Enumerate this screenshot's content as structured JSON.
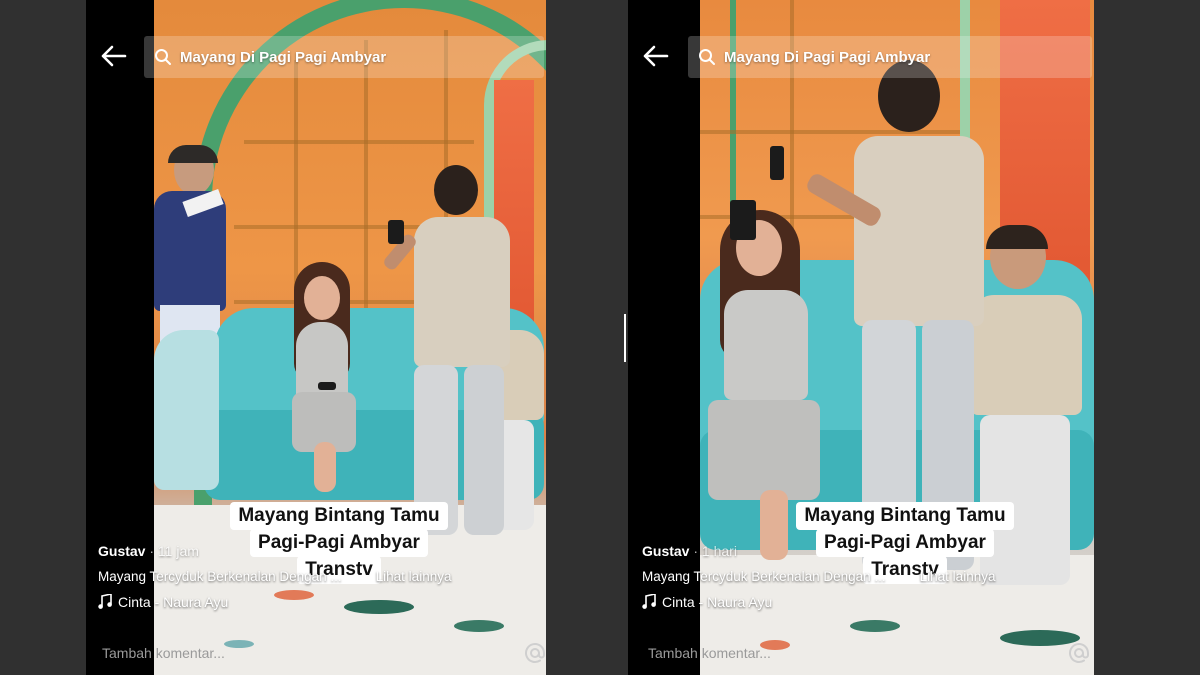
{
  "screens": [
    {
      "search": {
        "query": "Mayang Di Pagi Pagi Ambyar"
      },
      "overlay_caption": [
        "Mayang Bintang Tamu",
        "Pagi-Pagi Ambyar",
        "Transtv"
      ],
      "author": "Gustav",
      "author_time": "· 11 jam",
      "description": "Mayang Tercyduk Berkenalan Dengan ...",
      "see_more": "Lihat lainnya",
      "music": "Cinta - Naura Ayu",
      "comment_placeholder": "Tambah komentar..."
    },
    {
      "search": {
        "query": "Mayang Di Pagi Pagi Ambyar"
      },
      "overlay_caption": [
        "Mayang Bintang Tamu",
        "Pagi-Pagi Ambyar",
        "Transtv"
      ],
      "author": "Gustav",
      "author_time": "· 1 hari",
      "description": "Mayang Tercyduk Berkenalan Dengan ...",
      "see_more": "Lihat lainnya",
      "music": "Cinta - Naura Ayu",
      "comment_placeholder": "Tambah komentar..."
    }
  ],
  "icons": {
    "back": "arrow-left-icon",
    "search": "search-icon",
    "music": "music-note-icon",
    "mention": "at-sign-icon"
  },
  "colors": {
    "wall": "#e48a3c",
    "sofa": "#54c2c8",
    "arch_green": "#4aa06c",
    "caption_bg": "#ffffff"
  }
}
